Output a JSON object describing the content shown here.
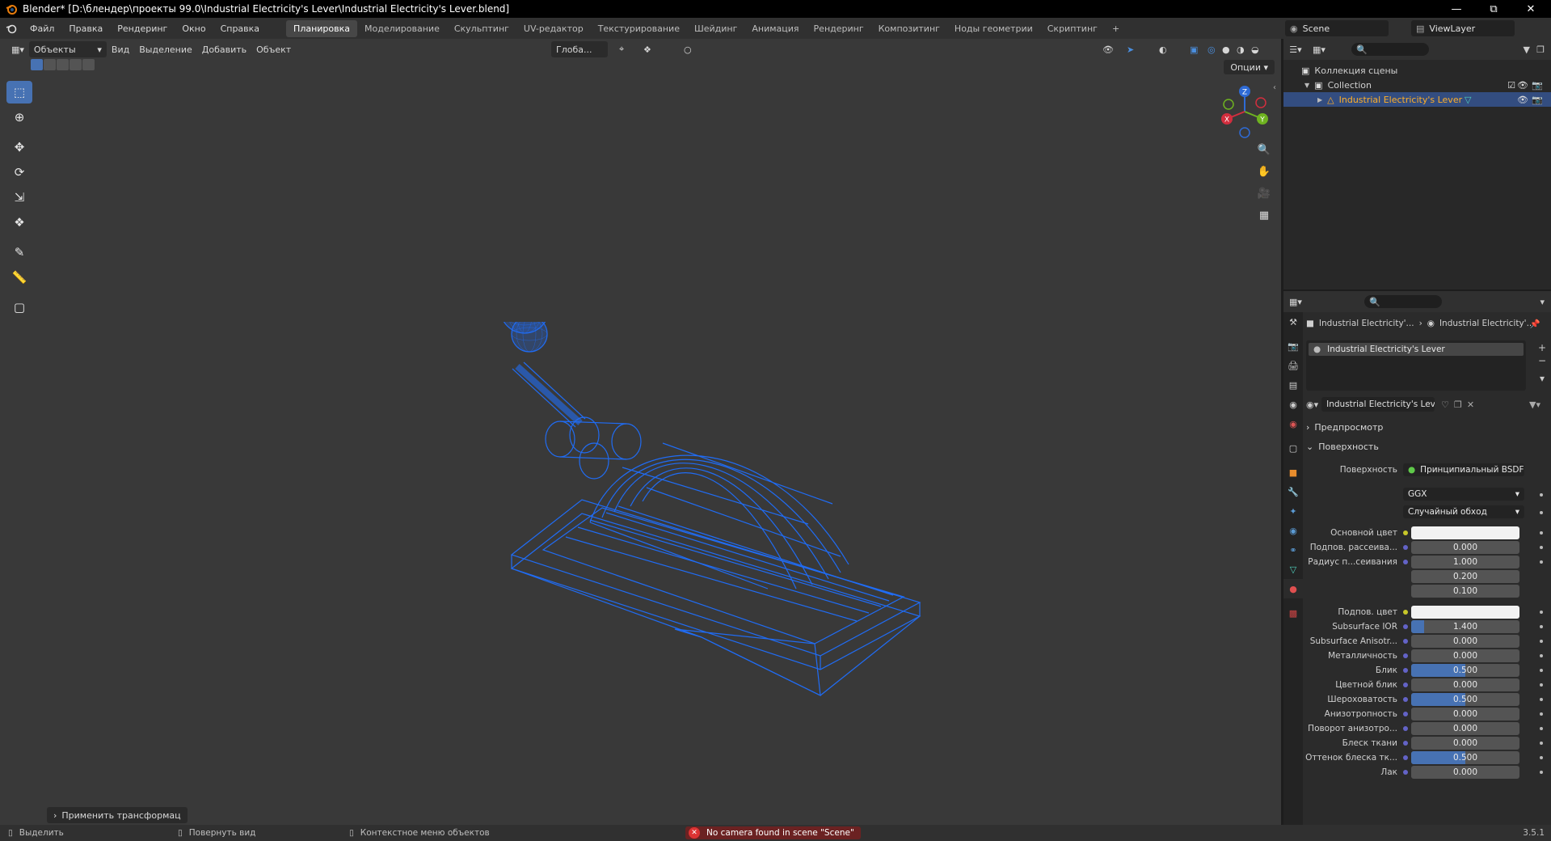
{
  "window": {
    "title": "Blender* [D:\\блендер\\проекты 99.0\\Industrial Electricity's Lever\\Industrial Electricity's Lever.blend]"
  },
  "menubar": {
    "menus": [
      "Файл",
      "Правка",
      "Рендеринг",
      "Окно",
      "Справка"
    ],
    "workspaces": [
      "Планировка",
      "Моделирование",
      "Скульптинг",
      "UV-редактор",
      "Текстурирование",
      "Шейдинг",
      "Анимация",
      "Рендеринг",
      "Композитинг",
      "Ноды геометрии",
      "Скриптинг"
    ],
    "active_workspace": "Планировка",
    "add_tab": "+",
    "scene": "Scene",
    "view_layer": "ViewLayer"
  },
  "viewport": {
    "mode": "Объекты",
    "menus": [
      "Вид",
      "Выделение",
      "Добавить",
      "Объект"
    ],
    "transform_orientation": "Глоба...",
    "options": "Опции",
    "gizmo_axes": {
      "x": "X",
      "y": "Y",
      "z": "Z"
    },
    "redo_panel": "Применить трансформац",
    "wire_color": "#1f6fff"
  },
  "outliner": {
    "scene_collection": "Коллекция сцены",
    "collection": "Collection",
    "object": "Industrial Electricity's Lever"
  },
  "properties": {
    "breadcrumb": [
      "Industrial Electricity'...",
      "Industrial Electricity'..."
    ],
    "material_slot": "Industrial Electricity's Lever",
    "material_name": "Industrial Electricity's Lever",
    "sections": {
      "preview": "Предпросмотр",
      "surface": "Поверхность"
    },
    "surface_label": "Поверхность",
    "surface_shader": "Принципиальный BSDF",
    "distribution": "GGX",
    "subsurface_method": "Случайный обход",
    "rows": [
      {
        "label": "Основной цвет",
        "type": "color",
        "value": ""
      },
      {
        "label": "Подпов. рассеива...",
        "type": "number",
        "value": "0.000",
        "fill": 0
      },
      {
        "label": "Радиус п...сеивания",
        "type": "number",
        "value": "1.000",
        "fill": 0
      },
      {
        "label": "",
        "type": "number",
        "value": "0.200",
        "fill": 0
      },
      {
        "label": "",
        "type": "number",
        "value": "0.100",
        "fill": 0
      },
      {
        "label": "Подпов. цвет",
        "type": "color",
        "value": ""
      },
      {
        "label": "Subsurface IOR",
        "type": "number",
        "value": "1.400",
        "fill": 0.12
      },
      {
        "label": "Subsurface Anisotr...",
        "type": "number",
        "value": "0.000",
        "fill": 0
      },
      {
        "label": "Металличность",
        "type": "number",
        "value": "0.000",
        "fill": 0
      },
      {
        "label": "Блик",
        "type": "number",
        "value": "0.500",
        "fill": 0.5
      },
      {
        "label": "Цветной блик",
        "type": "number",
        "value": "0.000",
        "fill": 0
      },
      {
        "label": "Шероховатость",
        "type": "number",
        "value": "0.500",
        "fill": 0.5
      },
      {
        "label": "Анизотропность",
        "type": "number",
        "value": "0.000",
        "fill": 0
      },
      {
        "label": "Поворот анизотро...",
        "type": "number",
        "value": "0.000",
        "fill": 0
      },
      {
        "label": "Блеск ткани",
        "type": "number",
        "value": "0.000",
        "fill": 0
      },
      {
        "label": "Оттенок блеска тк...",
        "type": "number",
        "value": "0.500",
        "fill": 0.5
      },
      {
        "label": "Лак",
        "type": "number",
        "value": "0.000",
        "fill": 0
      }
    ]
  },
  "statusbar": {
    "select": "Выделить",
    "rotate_view": "Повернуть вид",
    "context_menu": "Контекстное меню объектов",
    "error": "No camera found in scene \"Scene\"",
    "version": "3.5.1"
  }
}
